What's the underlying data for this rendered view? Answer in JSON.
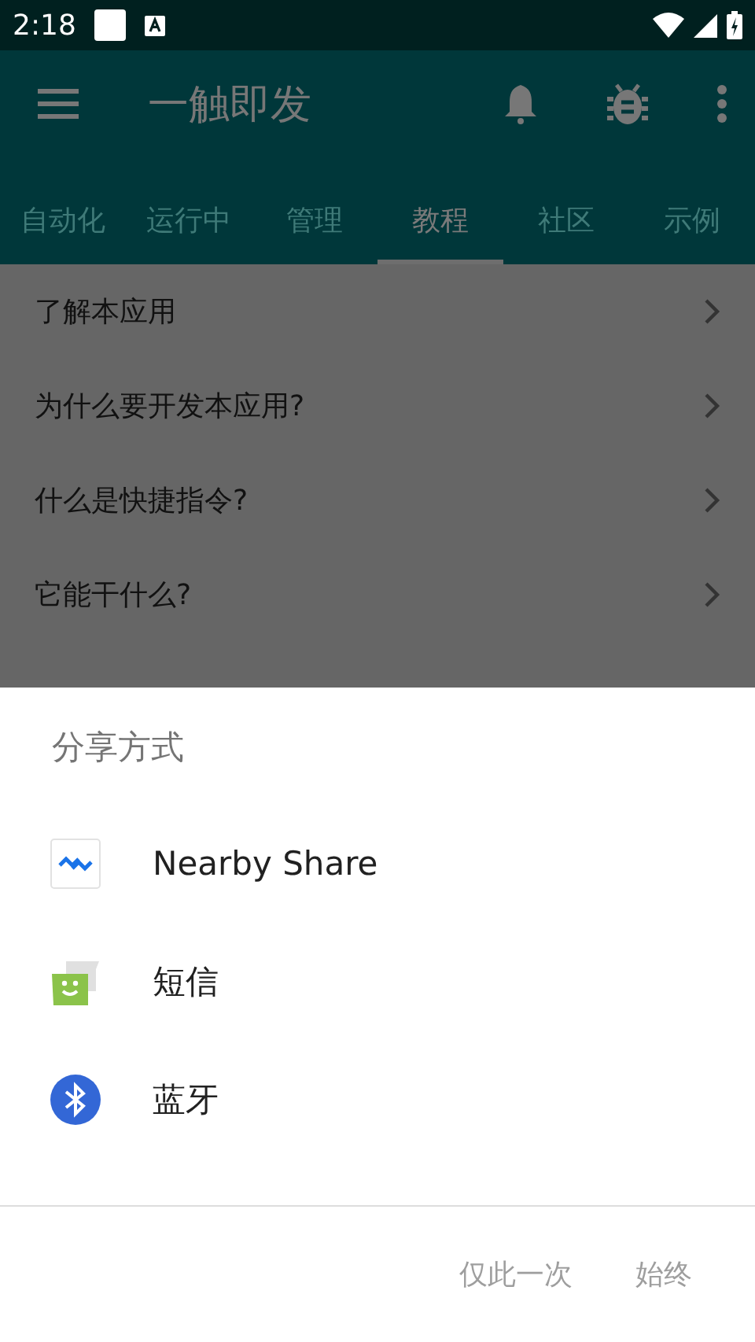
{
  "status_bar": {
    "time": "2:18"
  },
  "app_bar": {
    "title": "一触即发"
  },
  "tabs": [
    {
      "label": "自动化",
      "selected": false
    },
    {
      "label": "运行中",
      "selected": false
    },
    {
      "label": "管理",
      "selected": false
    },
    {
      "label": "教程",
      "selected": true
    },
    {
      "label": "社区",
      "selected": false
    },
    {
      "label": "示例",
      "selected": false
    }
  ],
  "tutorials": [
    {
      "title": "了解本应用"
    },
    {
      "title": "为什么要开发本应用?"
    },
    {
      "title": "什么是快捷指令?"
    },
    {
      "title": "它能干什么?"
    }
  ],
  "share_sheet": {
    "title": "分享方式",
    "targets": [
      {
        "kind": "nearby",
        "label": "Nearby Share"
      },
      {
        "kind": "messages",
        "label": "短信"
      },
      {
        "kind": "bluetooth",
        "label": "蓝牙"
      }
    ],
    "buttons": [
      {
        "label": "仅此一次",
        "disabled": true
      },
      {
        "label": "始终",
        "disabled": true
      }
    ]
  }
}
